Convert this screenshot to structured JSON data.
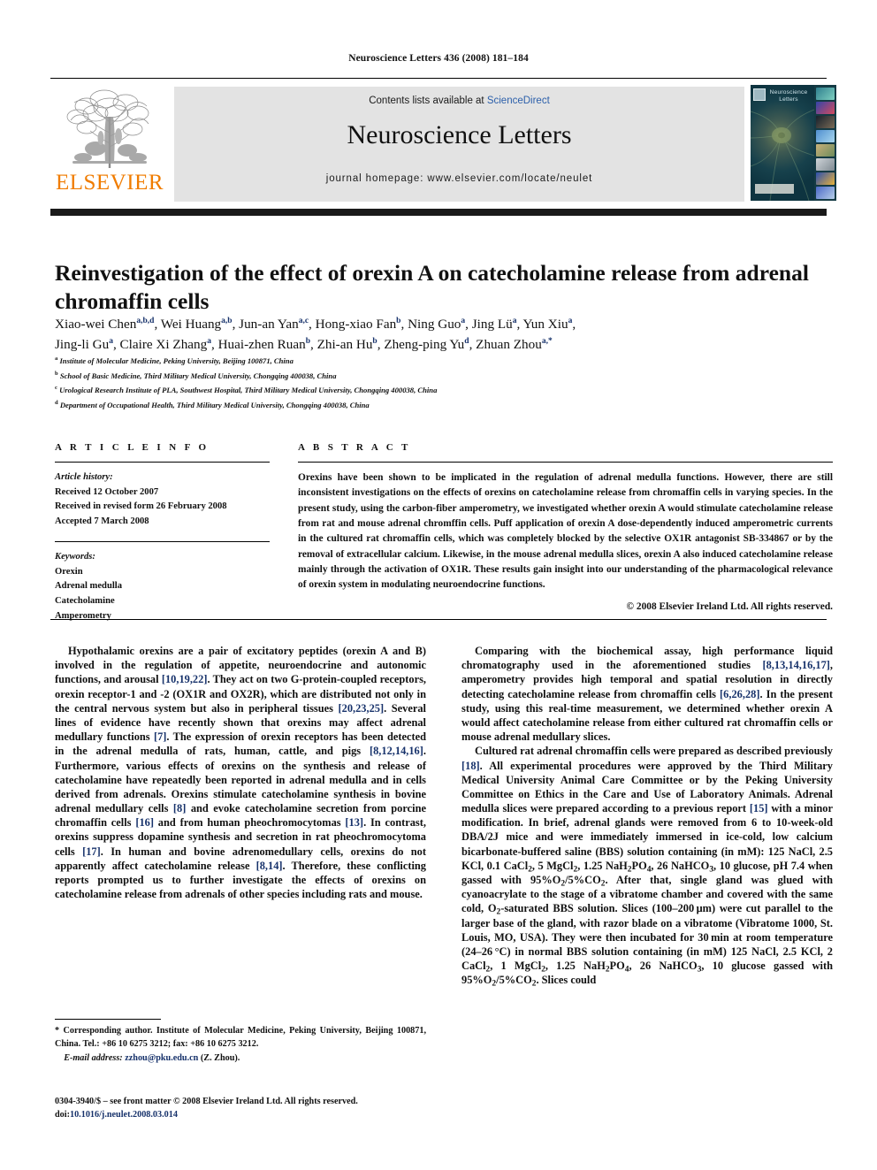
{
  "running_head": "Neuroscience Letters 436 (2008) 181–184",
  "masthead": {
    "contents_prefix": "Contents lists available at ",
    "sciencedirect": "ScienceDirect",
    "journal_title": "Neuroscience Letters",
    "homepage": "journal homepage: www.elsevier.com/locate/neulet",
    "publisher_wordmark": "ELSEVIER",
    "cover_title": "Neuroscience Letters",
    "link_color": "#2b5faa",
    "elsevier_orange": "#f07c00"
  },
  "article": {
    "title": "Reinvestigation of the effect of orexin A on catecholamine release from adrenal chromaffin cells",
    "authors_line1": "Xiao-wei Chen",
    "authors": [
      {
        "name": "Xiao-wei Chen",
        "sup": "a,b,d"
      },
      {
        "name": "Wei Huang",
        "sup": "a,b"
      },
      {
        "name": "Jun-an Yan",
        "sup": "a,c"
      },
      {
        "name": "Hong-xiao Fan",
        "sup": "b"
      },
      {
        "name": "Ning Guo",
        "sup": "a"
      },
      {
        "name": "Jing Lü",
        "sup": "a"
      },
      {
        "name": "Yun Xiu",
        "sup": "a"
      },
      {
        "name": "Jing-li Gu",
        "sup": "a"
      },
      {
        "name": "Claire Xi Zhang",
        "sup": "a"
      },
      {
        "name": "Huai-zhen Ruan",
        "sup": "b"
      },
      {
        "name": "Zhi-an Hu",
        "sup": "b"
      },
      {
        "name": "Zheng-ping Yu",
        "sup": "d"
      },
      {
        "name": "Zhuan Zhou",
        "sup": "a,*"
      }
    ],
    "affiliations": [
      {
        "label": "a",
        "text": "Institute of Molecular Medicine, Peking University, Beijing 100871, China"
      },
      {
        "label": "b",
        "text": "School of Basic Medicine, Third Military Medical University, Chongqing 400038, China"
      },
      {
        "label": "c",
        "text": "Urological Research Institute of PLA, Southwest Hospital, Third Military Medical University, Chongqing 400038, China"
      },
      {
        "label": "d",
        "text": "Department of Occupational Health, Third Military Medical University, Chongqing 400038, China"
      }
    ]
  },
  "article_info": {
    "heading": "A R T I C L E   I N F O",
    "history_label": "Article history:",
    "history": [
      "Received 12 October 2007",
      "Received in revised form 26 February 2008",
      "Accepted 7 March 2008"
    ],
    "keywords_label": "Keywords:",
    "keywords": [
      "Orexin",
      "Adrenal medulla",
      "Catecholamine",
      "Amperometry"
    ]
  },
  "abstract": {
    "heading": "A B S T R A C T",
    "text": "Orexins have been shown to be implicated in the regulation of adrenal medulla functions. However, there are still inconsistent investigations on the effects of orexins on catecholamine release from chromaffin cells in varying species. In the present study, using the carbon-fiber amperometry, we investigated whether orexin A would stimulate catecholamine release from rat and mouse adrenal chromffin cells. Puff application of orexin A dose-dependently induced amperometric currents in the cultured rat chromaffin cells, which was completely blocked by the selective OX1R antagonist SB-334867 or by the removal of extracellular calcium. Likewise, in the mouse adrenal medulla slices, orexin A also induced catecholamine release mainly through the activation of OX1R. These results gain insight into our understanding of the pharmacological relevance of orexin system in modulating neuroendocrine functions.",
    "copyright": "© 2008 Elsevier Ireland Ltd. All rights reserved."
  },
  "body": {
    "left_paragraph": "Hypothalamic orexins are a pair of excitatory peptides (orexin A and B) involved in the regulation of appetite, neuroendocrine and autonomic functions, and arousal [10,19,22]. They act on two G-protein-coupled receptors, orexin receptor-1 and -2 (OX1R and OX2R), which are distributed not only in the central nervous system but also in peripheral tissues [20,23,25]. Several lines of evidence have recently shown that orexins may affect adrenal medullary functions [7]. The expression of orexin receptors has been detected in the adrenal medulla of rats, human, cattle, and pigs [8,12,14,16]. Furthermore, various effects of orexins on the synthesis and release of catecholamine have repeatedly been reported in adrenal medulla and in cells derived from adrenals. Orexins stimulate catecholamine synthesis in bovine adrenal medullary cells [8] and evoke catecholamine secretion from porcine chromaffin cells [16] and from human pheochromocytomas [13]. In contrast, orexins suppress dopamine synthesis and secretion in rat pheochromocytoma cells [17]. In human and bovine adrenomedullary cells, orexins do not apparently affect catecholamine release [8,14]. Therefore, these conflicting reports prompted us to further investigate the effects of orexins on catecholamine release from adrenals of other species including rats and mouse.",
    "right_paragraph_1": "Comparing with the biochemical assay, high performance liquid chromatography used in the aforementioned studies [8,13,14,16,17], amperometry provides high temporal and spatial resolution in directly detecting catecholamine release from chromaffin cells [6,26,28]. In the present study, using this real-time measurement, we determined whether orexin A would affect catecholamine release from either cultured rat chromaffin cells or mouse adrenal medullary slices.",
    "right_paragraph_2": "Cultured rat adrenal chromaffin cells were prepared as described previously [18]. All experimental procedures were approved by the Third Military Medical University Animal Care Committee or by the Peking University Committee on Ethics in the Care and Use of Laboratory Animals. Adrenal medulla slices were prepared according to a previous report [15] with a minor modification. In brief, adrenal glands were removed from 6 to 10-week-old DBA/2J mice and were immediately immersed in ice-cold, low calcium bicarbonate-buffered saline (BBS) solution containing (in mM): 125 NaCl, 2.5 KCl, 0.1 CaCl2, 5 MgCl2, 1.25 NaH2PO4, 26 NaHCO3, 10 glucose, pH 7.4 when gassed with 95%O2/5%CO2. After that, single gland was glued with cyanoacrylate to the stage of a vibratome chamber and covered with the same cold, O2-saturated BBS solution. Slices (100–200 μm) were cut parallel to the larger base of the gland, with razor blade on a vibratome (Vibratome 1000, St. Louis, MO, USA). They were then incubated for 30 min at room temperature (24–26 °C) in normal BBS solution containing (in mM) 125 NaCl, 2.5 KCl, 2 CaCl2, 1 MgCl2, 1.25 NaH2PO4, 26 NaHCO3, 10 glucose gassed with 95%O2/5%CO2. Slices could"
  },
  "footnotes": {
    "corresponding": "* Corresponding author. Institute of Molecular Medicine, Peking University, Beijing 100871, China. Tel.: +86 10 6275 3212; fax: +86 10 6275 3212.",
    "email_label": "E-mail address:",
    "email": "zzhou@pku.edu.cn",
    "email_suffix": "(Z. Zhou).",
    "front_matter": "0304-3940/$ – see front matter © 2008 Elsevier Ireland Ltd. All rights reserved.",
    "doi_label": "doi:",
    "doi": "10.1016/j.neulet.2008.03.014"
  }
}
